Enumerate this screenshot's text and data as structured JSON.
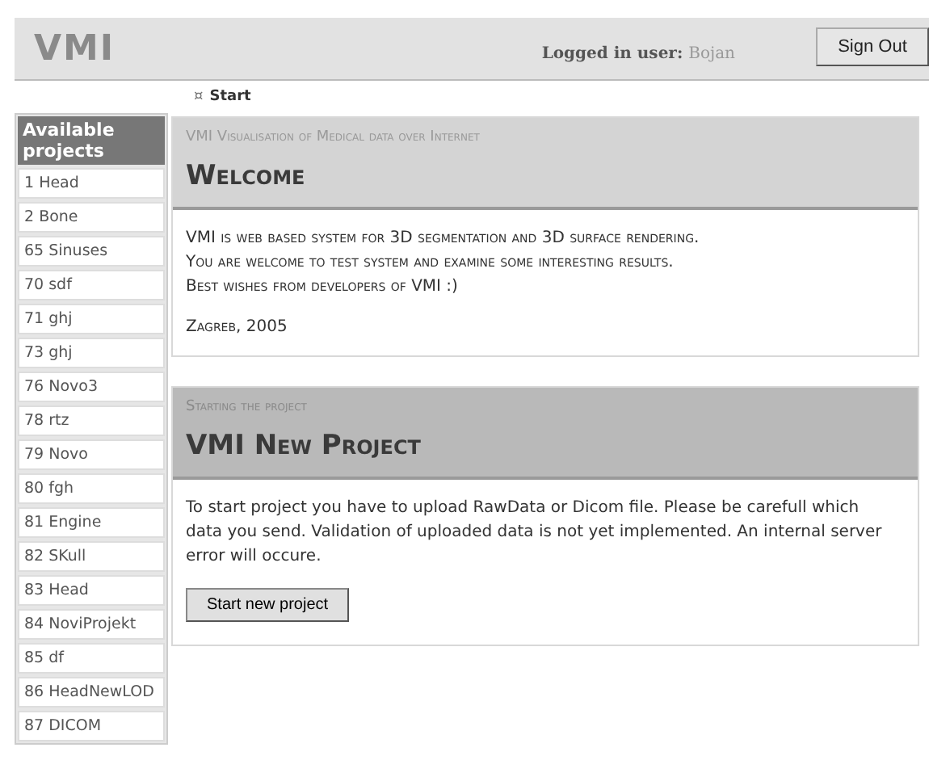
{
  "header": {
    "logo": "VMI",
    "user_label": "Logged in user:",
    "user_name": "Bojan",
    "sign_out": "Sign Out"
  },
  "breadcrumb": {
    "marker": "¤",
    "label": "Start"
  },
  "sidebar": {
    "title": "Available projects",
    "items": [
      {
        "label": "1 Head"
      },
      {
        "label": "2 Bone"
      },
      {
        "label": "65 Sinuses"
      },
      {
        "label": "70 sdf"
      },
      {
        "label": "71 ghj"
      },
      {
        "label": "73 ghj"
      },
      {
        "label": "76 Novo3"
      },
      {
        "label": "78 rtz"
      },
      {
        "label": "79 Novo"
      },
      {
        "label": "80 fgh"
      },
      {
        "label": "81 Engine"
      },
      {
        "label": "82 SKull"
      },
      {
        "label": "83 Head"
      },
      {
        "label": "84 NoviProjekt"
      },
      {
        "label": "85 df"
      },
      {
        "label": "86 HeadNewLOD"
      },
      {
        "label": "87 DICOM"
      }
    ]
  },
  "panels": [
    {
      "kind": "welcome",
      "subtitle": "VMI Visualisation of Medical data over Internet",
      "title": "Welcome",
      "lines": [
        "VMI is web based system for 3D segmentation and 3D surface rendering.",
        "You are welcome to test system and examine some interesting results.",
        "Best wishes from developers of VMI :)"
      ],
      "footer": "Zagreb, 2005"
    },
    {
      "kind": "action",
      "subtitle": "Starting the project",
      "title": "VMI New Project",
      "text": "To start project you have to upload RawData or Dicom file. Please be carefull which data you send. Validation of uploaded data is not yet implemented. An internal server error will occure.",
      "button": "Start new project"
    }
  ]
}
